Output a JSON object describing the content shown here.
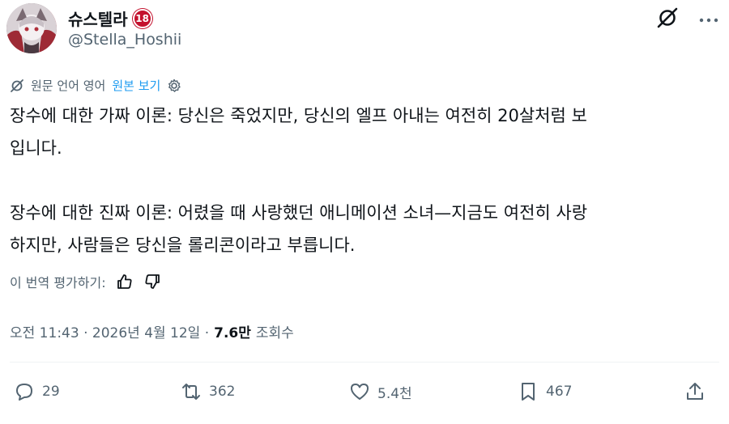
{
  "author": {
    "display_name": "슈스텔라",
    "age_badge": "18",
    "handle": "@Stella_Hoshii",
    "avatar_icon": "avatar-image"
  },
  "translation": {
    "label": "원문 언어 영어",
    "show_original": "원본 보기"
  },
  "tweet": {
    "para1_line1": "장수에 대한 가짜 이론: 당신은 죽었지만, 당신의 엘프 아내는 여전히 20살처럼 보",
    "para1_line2": "입니다.",
    "para2_line1": "장수에 대한 진짜 이론: 어렸을 때 사랑했던 애니메이션 소녀—지금도 여전히 사랑",
    "para2_line2": "하지만, 사람들은 당신을 롤리콘이라고 부릅니다."
  },
  "rate": {
    "label": "이 번역 평가하기:"
  },
  "meta": {
    "timestamp": "오전 11:43 · 2026년 4월 12일 ·",
    "views_count": "7.6만",
    "views_label": "조회수"
  },
  "actions": {
    "replies": "29",
    "reposts": "362",
    "likes": "5.4천",
    "bookmarks": "467"
  },
  "colors": {
    "accent": "#1d9bf0",
    "secondary_text": "#536471",
    "badge": "#c4122e"
  }
}
